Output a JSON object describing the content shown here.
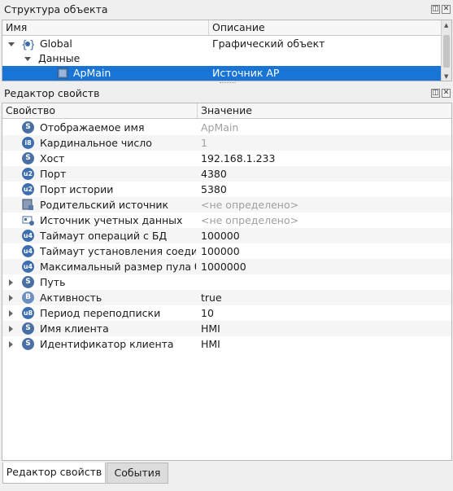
{
  "structure_panel": {
    "title": "Структура объекта",
    "columns": [
      "Имя",
      "Описание"
    ],
    "rows": [
      {
        "name": "Global",
        "description": "Графический объект"
      },
      {
        "name": "Данные",
        "description": ""
      },
      {
        "name": "ApMain",
        "description": "Источник AP"
      }
    ],
    "icons": {
      "global": "object-braces-icon",
      "apmain": "source-icon"
    }
  },
  "property_panel": {
    "title": "Редактор свойств",
    "columns": [
      "Свойство",
      "Значение"
    ],
    "rows": [
      {
        "type": "S",
        "label": "Отображаемое имя",
        "value": "ApMain"
      },
      {
        "type": "i8",
        "label": "Кардинальное число",
        "value": "1"
      },
      {
        "type": "S",
        "label": "Хост",
        "value": "192.168.1.233"
      },
      {
        "type": "u2",
        "label": "Порт",
        "value": "4380"
      },
      {
        "type": "u2",
        "label": "Порт истории",
        "value": "5380"
      },
      {
        "type": "src",
        "label": "Родительский источник",
        "value": "<не определено>"
      },
      {
        "type": "cred",
        "label": "Источник учетных данных",
        "value": "<не определено>"
      },
      {
        "type": "u4",
        "label": "Таймаут операций с БД",
        "value": "100000"
      },
      {
        "type": "u4",
        "label": "Таймаут установления соеди...",
        "value": "100000"
      },
      {
        "type": "u4",
        "label": "Максимальный размер пула б...",
        "value": "1000000"
      },
      {
        "type": "S",
        "label": "Путь",
        "value": ""
      },
      {
        "type": "B",
        "label": "Активность",
        "value": "true"
      },
      {
        "type": "u8",
        "label": "Период переподписки",
        "value": "10"
      },
      {
        "type": "S",
        "label": "Имя клиента",
        "value": "HMI"
      },
      {
        "type": "S",
        "label": "Идентификатор клиента",
        "value": "HMI"
      }
    ]
  },
  "tabs": [
    "Редактор свойств",
    "События"
  ],
  "colors": {
    "selection": "#1874d5",
    "badge": "#4a6fa5"
  }
}
